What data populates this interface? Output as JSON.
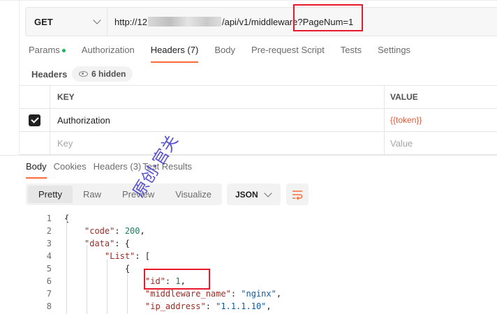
{
  "request": {
    "method": "GET",
    "url_prefix": "http://12",
    "url_suffix": "/api/v1/middleware?PageNum=1"
  },
  "request_tabs": [
    {
      "label": "Params",
      "active": false
    },
    {
      "label": "Authorization",
      "active": false
    },
    {
      "label": "Headers (7)",
      "active": true
    },
    {
      "label": "Body",
      "active": false
    },
    {
      "label": "Pre-request Script",
      "active": false
    },
    {
      "label": "Tests",
      "active": false
    },
    {
      "label": "Settings",
      "active": false
    }
  ],
  "headers_section": {
    "label": "Headers",
    "hidden_count": "6 hidden",
    "columns": {
      "key": "KEY",
      "value": "VALUE"
    },
    "rows": [
      {
        "key": "Authorization",
        "value": "{{token}}",
        "checked": true
      }
    ],
    "placeholder": {
      "key": "Key",
      "value": "Value"
    }
  },
  "response_tabs": [
    {
      "label": "Body",
      "active": true
    },
    {
      "label": "Cookies",
      "active": false
    },
    {
      "label": "Headers (3)",
      "active": false
    },
    {
      "label": "Test Results",
      "active": false
    }
  ],
  "view_modes": [
    {
      "label": "Pretty",
      "active": true
    },
    {
      "label": "Raw",
      "active": false
    },
    {
      "label": "Preview",
      "active": false
    },
    {
      "label": "Visualize",
      "active": false
    }
  ],
  "format": "JSON",
  "code_lines": [
    {
      "n": "1",
      "indent": 0,
      "parts": [
        [
          "p",
          "{"
        ]
      ]
    },
    {
      "n": "2",
      "indent": 1,
      "parts": [
        [
          "k",
          "\"code\""
        ],
        [
          "p",
          ": "
        ],
        [
          "n",
          "200"
        ],
        [
          "p",
          ","
        ]
      ]
    },
    {
      "n": "3",
      "indent": 1,
      "parts": [
        [
          "k",
          "\"data\""
        ],
        [
          "p",
          ": {"
        ]
      ]
    },
    {
      "n": "4",
      "indent": 2,
      "parts": [
        [
          "k",
          "\"List\""
        ],
        [
          "p",
          ": ["
        ]
      ]
    },
    {
      "n": "5",
      "indent": 3,
      "parts": [
        [
          "p",
          "{"
        ]
      ]
    },
    {
      "n": "6",
      "indent": 4,
      "parts": [
        [
          "k",
          "\"id\""
        ],
        [
          "p",
          ": "
        ],
        [
          "n",
          "1"
        ],
        [
          "p",
          ","
        ]
      ]
    },
    {
      "n": "7",
      "indent": 4,
      "parts": [
        [
          "k",
          "\"middleware_name\""
        ],
        [
          "p",
          ": "
        ],
        [
          "s",
          "\"nginx\""
        ],
        [
          "p",
          ","
        ]
      ]
    },
    {
      "n": "8",
      "indent": 4,
      "parts": [
        [
          "k",
          "\"ip_address\""
        ],
        [
          "p",
          ": "
        ],
        [
          "s",
          "\"1.1.1.10\""
        ],
        [
          "p",
          ","
        ]
      ]
    }
  ],
  "watermark": "原创·官关",
  "colors": {
    "accent": "#ff6c37",
    "highlight_box": "#e8192c",
    "params_dot": "#0cbb52"
  }
}
